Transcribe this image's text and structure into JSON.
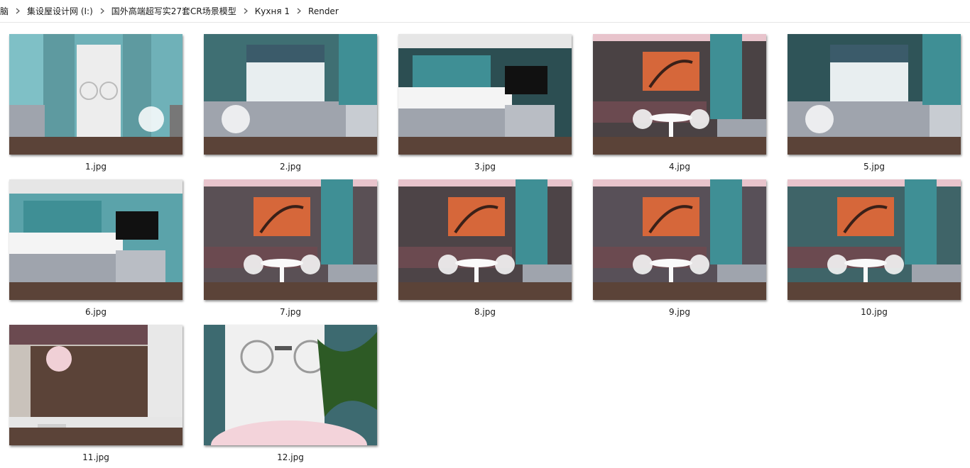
{
  "breadcrumb": {
    "items": [
      "脑",
      "集设屋设计网 (I:)",
      "国外高端超写实27套CR场景模型",
      "Кухня 1",
      "Render"
    ]
  },
  "files": [
    {
      "name": "1.jpg",
      "scene": "door",
      "wall": "#6fb1b8"
    },
    {
      "name": "2.jpg",
      "scene": "window",
      "wall": "#3f6f73"
    },
    {
      "name": "3.jpg",
      "scene": "cabinets",
      "wall": "#2c4e52"
    },
    {
      "name": "4.jpg",
      "scene": "painting",
      "wall": "#4a4244"
    },
    {
      "name": "5.jpg",
      "scene": "window",
      "wall": "#2f5458"
    },
    {
      "name": "6.jpg",
      "scene": "cabinets",
      "wall": "#5ba3aa"
    },
    {
      "name": "7.jpg",
      "scene": "painting",
      "wall": "#5a5055"
    },
    {
      "name": "8.jpg",
      "scene": "painting",
      "wall": "#4d4447"
    },
    {
      "name": "9.jpg",
      "scene": "painting",
      "wall": "#585058"
    },
    {
      "name": "10.jpg",
      "scene": "painting",
      "wall": "#3f6468"
    },
    {
      "name": "11.jpg",
      "scene": "topdown",
      "wall": "#6a4c3c"
    },
    {
      "name": "12.jpg",
      "scene": "closeup",
      "wall": "#3d6a70"
    }
  ],
  "colors": {
    "floor": "#5b4338",
    "cabinet": "#9fa4ad",
    "teal": "#3f8f95",
    "painting": "#d6673a",
    "sofa": "#6b4a50",
    "white": "#f2f2f2"
  }
}
